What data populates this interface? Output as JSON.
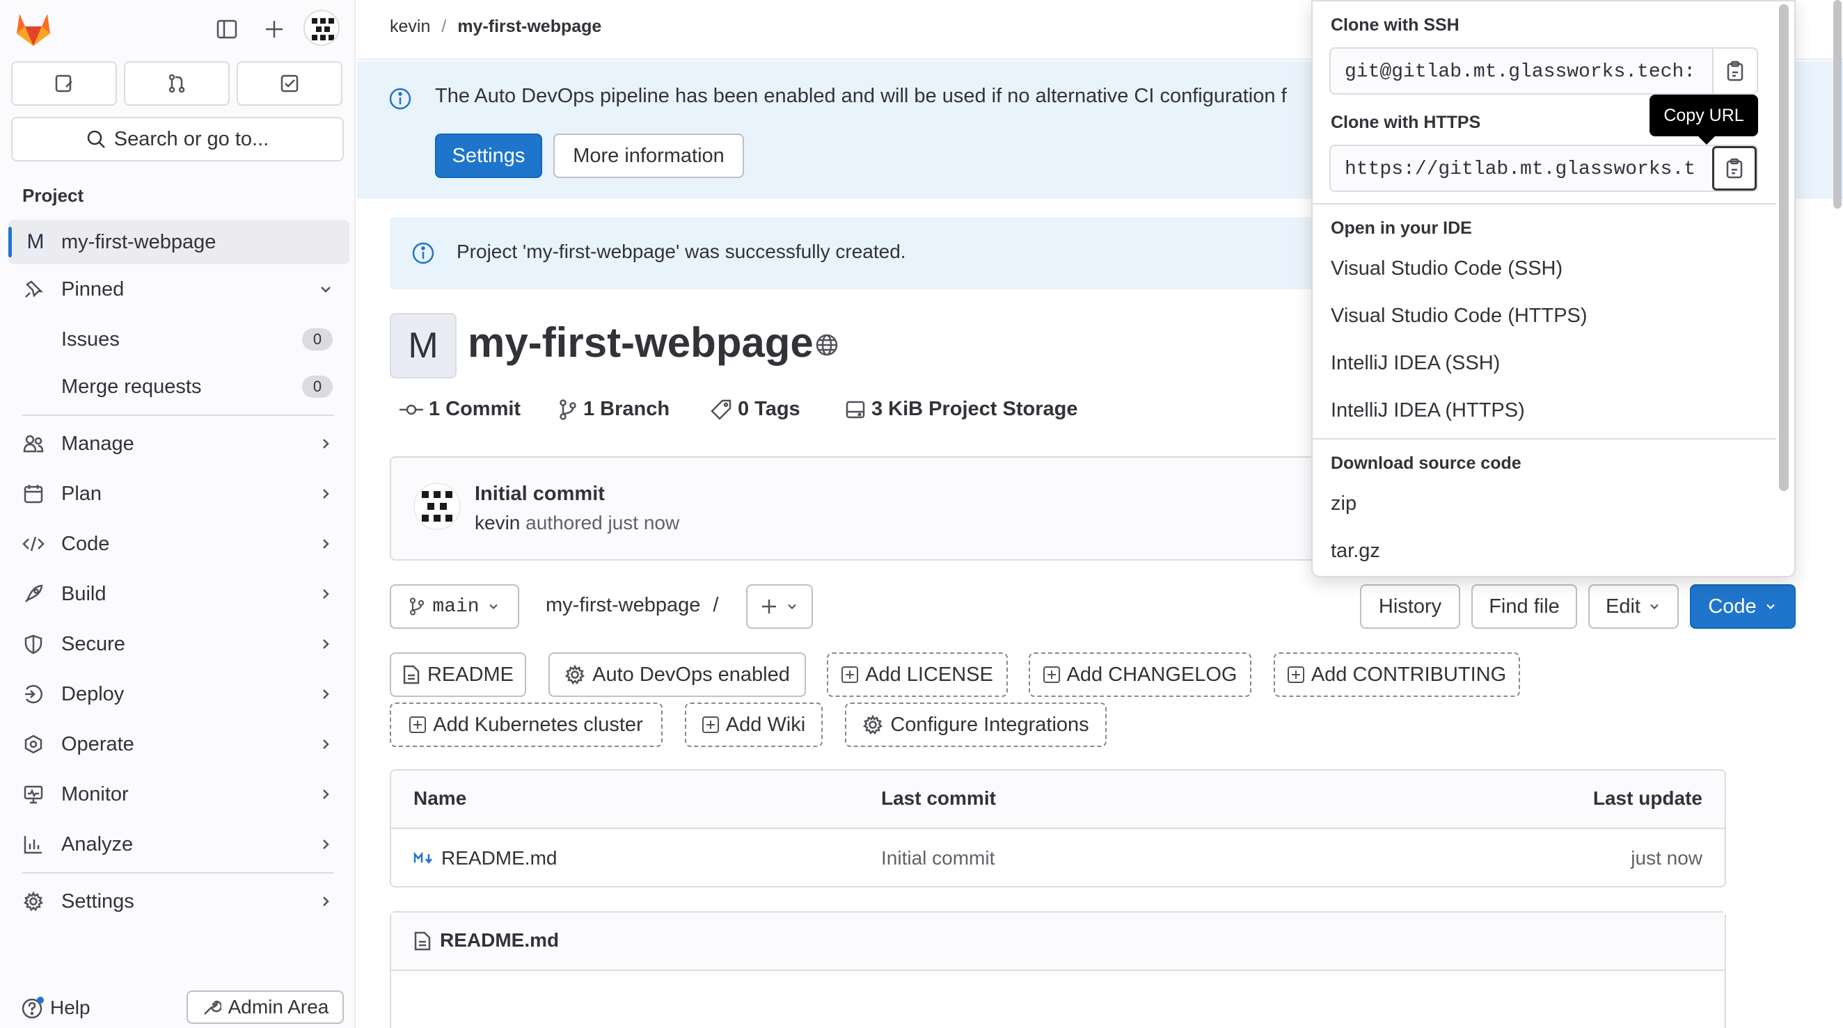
{
  "sidebar": {
    "search_label": "Search or go to...",
    "section_label": "Project",
    "project": {
      "initial": "M",
      "name": "my-first-webpage"
    },
    "pinned": {
      "label": "Pinned",
      "items": [
        {
          "label": "Issues",
          "count": "0"
        },
        {
          "label": "Merge requests",
          "count": "0"
        }
      ]
    },
    "nav": [
      {
        "label": "Manage",
        "icon": "users-icon"
      },
      {
        "label": "Plan",
        "icon": "calendar-icon"
      },
      {
        "label": "Code",
        "icon": "code-icon"
      },
      {
        "label": "Build",
        "icon": "rocket-icon"
      },
      {
        "label": "Secure",
        "icon": "shield-icon"
      },
      {
        "label": "Deploy",
        "icon": "deploy-icon"
      },
      {
        "label": "Operate",
        "icon": "cloud-gear-icon"
      },
      {
        "label": "Monitor",
        "icon": "monitor-icon"
      },
      {
        "label": "Analyze",
        "icon": "chart-icon"
      }
    ],
    "settings_label": "Settings",
    "help_label": "Help",
    "admin_label": "Admin Area"
  },
  "breadcrumb": {
    "user": "kevin",
    "separator": "/",
    "project": "my-first-webpage"
  },
  "devops_banner": {
    "message": "The Auto DevOps pipeline has been enabled and will be used if no alternative CI configuration f",
    "settings_button": "Settings",
    "more_info_button": "More information"
  },
  "alert": {
    "message": "Project 'my-first-webpage' was successfully created."
  },
  "project": {
    "initial": "M",
    "title": "my-first-webpage",
    "stats": {
      "commits": {
        "count": "1",
        "label": "Commit"
      },
      "branches": {
        "count": "1",
        "label": "Branch"
      },
      "tags": {
        "count": "0",
        "label": "Tags"
      },
      "storage": {
        "count": "3 KiB",
        "label": "Project Storage"
      }
    }
  },
  "last_commit": {
    "title": "Initial commit",
    "author": "kevin",
    "meta": "authored just now"
  },
  "repo_toolbar": {
    "branch": "main",
    "path": "my-first-webpage",
    "path_sep": "/",
    "history": "History",
    "find_file": "Find file",
    "edit": "Edit",
    "code": "Code"
  },
  "quick_actions": [
    {
      "label": "README",
      "style": "solid",
      "icon": "file-icon"
    },
    {
      "label": "Auto DevOps enabled",
      "style": "solid",
      "icon": "gear-icon"
    },
    {
      "label": "Add LICENSE",
      "style": "dashed",
      "icon": "plus-square-icon"
    },
    {
      "label": "Add CHANGELOG",
      "style": "dashed",
      "icon": "plus-square-icon"
    },
    {
      "label": "Add CONTRIBUTING",
      "style": "dashed",
      "icon": "plus-square-icon"
    },
    {
      "label": "Add Kubernetes cluster",
      "style": "dashed",
      "icon": "plus-square-icon"
    },
    {
      "label": "Add Wiki",
      "style": "dashed",
      "icon": "plus-square-icon"
    },
    {
      "label": "Configure Integrations",
      "style": "dashed",
      "icon": "gear-icon"
    }
  ],
  "file_table": {
    "headers": {
      "name": "Name",
      "last_commit": "Last commit",
      "last_update": "Last update"
    },
    "rows": [
      {
        "name": "README.md",
        "last_commit": "Initial commit",
        "last_update": "just now"
      }
    ]
  },
  "readme": {
    "title": "README.md"
  },
  "clone_dropdown": {
    "ssh_label": "Clone with SSH",
    "ssh_url": "git@gitlab.mt.glassworks.tech:",
    "https_label": "Clone with HTTPS",
    "https_url": "https://gitlab.mt.glassworks.t",
    "ide_label": "Open in your IDE",
    "ide_items": [
      "Visual Studio Code (SSH)",
      "Visual Studio Code (HTTPS)",
      "IntelliJ IDEA (SSH)",
      "IntelliJ IDEA (HTTPS)"
    ],
    "download_label": "Download source code",
    "download_items": [
      "zip",
      "tar.gz"
    ],
    "tooltip": "Copy URL"
  },
  "colors": {
    "primary": "#1f75cb",
    "banner_bg": "#e9f3fc",
    "sidebar_bg": "#fbfafd",
    "logo_orange": "#fc6d26"
  }
}
